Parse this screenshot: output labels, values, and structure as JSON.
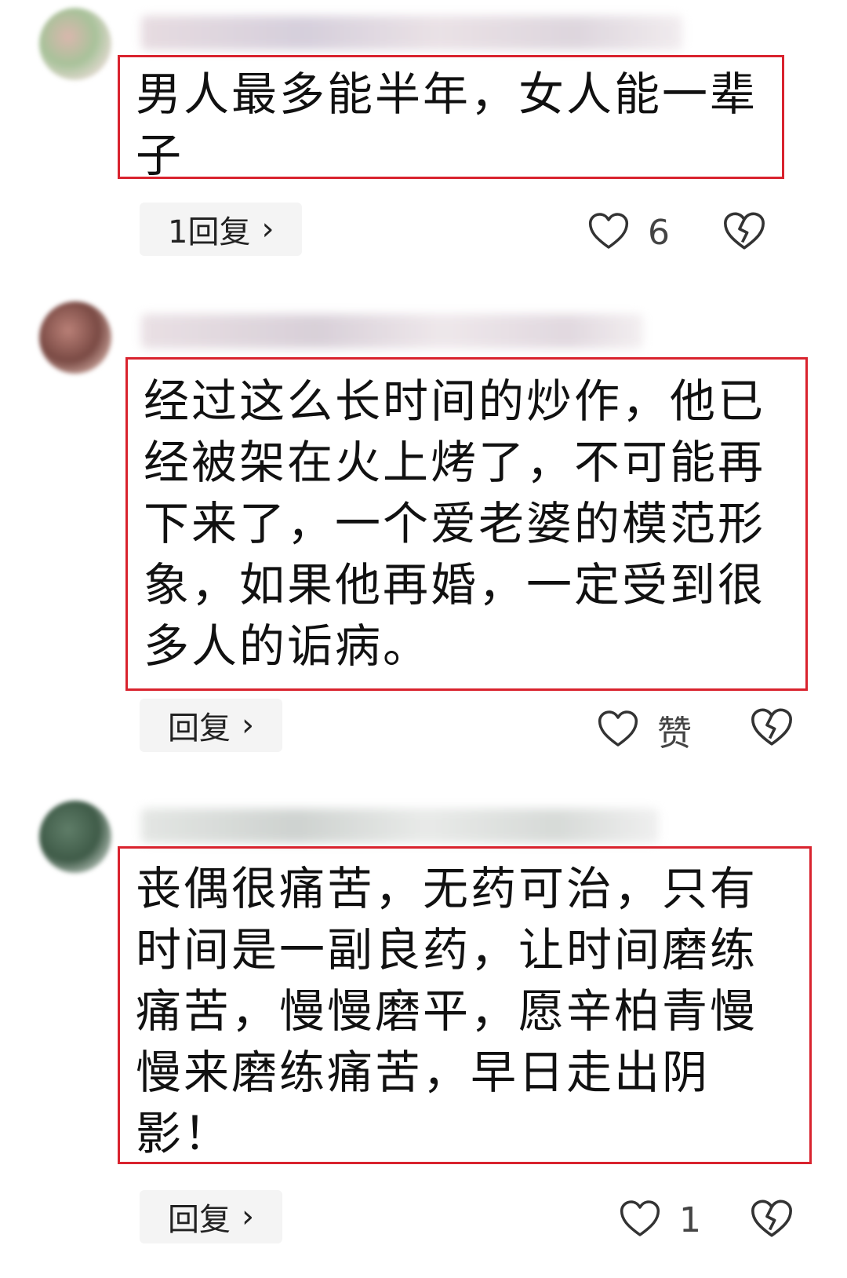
{
  "comments": [
    {
      "lines": [
        "男人最多能半年，女人能一辈",
        "子"
      ],
      "reply_label": "1回复",
      "like_count": "6",
      "avatar_colors": [
        "#c9a7a1",
        "#b9c8a8",
        "#e3d2cb"
      ]
    },
    {
      "lines": [
        "经过这么长时间的炒作，他已",
        "经被架在火上烤了，不可能再",
        "下来了，一个爱老婆的模范形",
        "象，如果他再婚，一定受到很",
        "多人的诟病。"
      ],
      "reply_label": "回复",
      "like_count": "赞",
      "avatar_colors": [
        "#a56a62",
        "#7e4a44",
        "#cfa89e"
      ]
    },
    {
      "lines": [
        "丧偶很痛苦，无药可治，只有",
        "时间是一副良药，让时间磨练",
        "痛苦，慢慢磨平，愿辛柏青慢",
        "慢来磨练痛苦，早日走出阴",
        "影！"
      ],
      "reply_label": "回复",
      "like_count": "1",
      "avatar_colors": [
        "#4f6e5a",
        "#6f8a75",
        "#c5d0c6"
      ]
    }
  ],
  "icons": {
    "chevron": "›",
    "like": "heart-outline-icon",
    "dislike": "broken-heart-icon"
  },
  "colors": {
    "highlight_border": "#d9232e",
    "reply_bg": "#f4f4f4"
  }
}
